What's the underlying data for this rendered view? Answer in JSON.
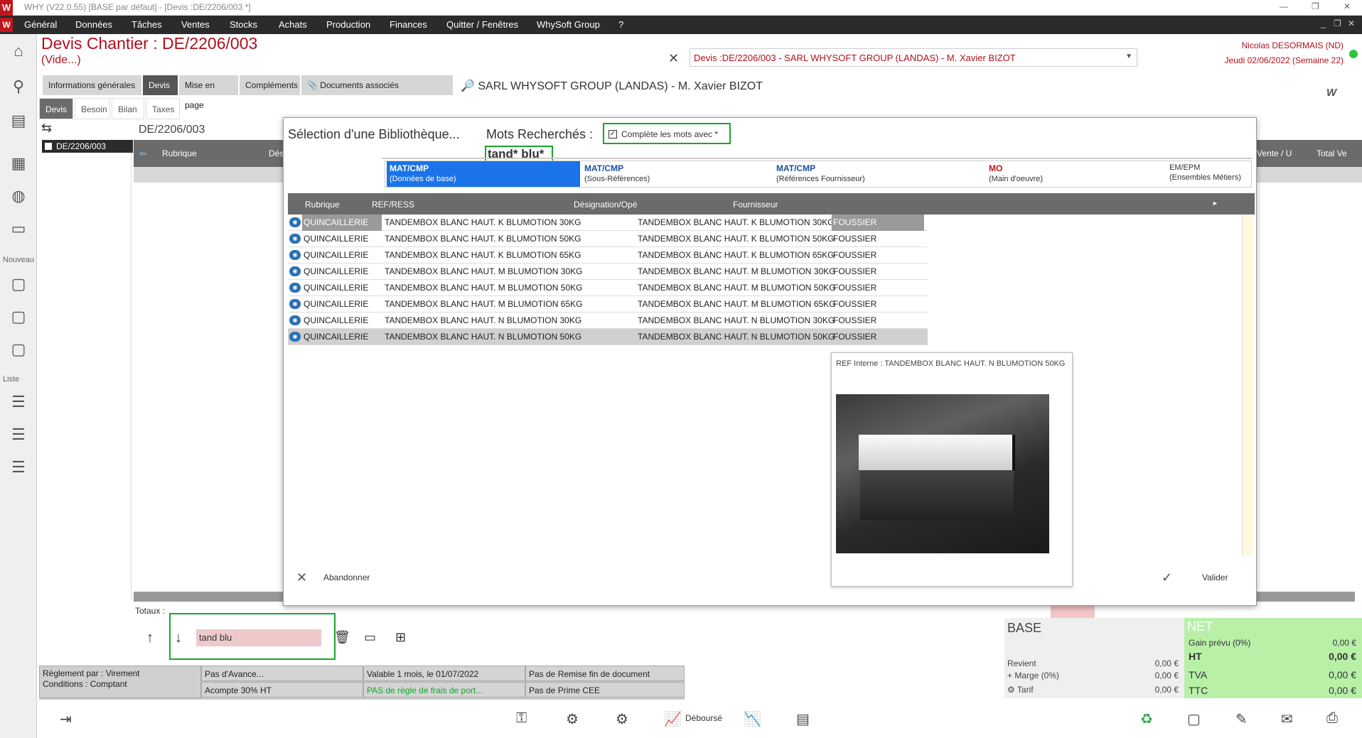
{
  "window": {
    "title": "WHY (V22.0.55)  [BASE par défaut] - [Devis :DE/2206/003 *]"
  },
  "menu": [
    "Général",
    "Données",
    "Tâches",
    "Ventes",
    "Stocks",
    "Achats",
    "Production",
    "Finances",
    "Quitter / Fenêtres",
    "WhySoft Group",
    "?"
  ],
  "header": {
    "title": "Devis  Chantier : DE/2206/003",
    "subtitle": "(Vide...)",
    "client_select": "Devis :DE/2206/003 - SARL WHYSOFT GROUP  (LANDAS) - M. Xavier BIZOT",
    "user": "Nicolas DESORMAIS (ND)",
    "date": "Jeudi 02/06/2022 (Semaine 22)",
    "client_line": "SARL WHYSOFT GROUP  (LANDAS) - M. Xavier BIZOT"
  },
  "tabs_main": [
    "Informations générales",
    "Devis",
    "Mise en page",
    "Compléments",
    "Documents associés"
  ],
  "tabs_sub": [
    "Devis",
    "Besoin",
    "Bilan",
    "Taxes"
  ],
  "sidebar": {
    "section_new": "Nouveau",
    "section_list": "Liste"
  },
  "tree": {
    "node": "DE/2206/003"
  },
  "doc": {
    "ref": "DE/2206/003"
  },
  "grid": {
    "headers": [
      "Rubrique",
      "Dés",
      "Vente / U",
      "Total Ve"
    ]
  },
  "totaux_label": "Totaux :",
  "search_field": "tand blu",
  "base": {
    "title": "BASE",
    "rows": [
      {
        "label": "Revient",
        "value": "0,00 €"
      },
      {
        "label": "+ Marge (0%)",
        "value": "0,00 €"
      },
      {
        "label": "Tarif",
        "value": "0,00 €"
      }
    ]
  },
  "net": {
    "title": "NET",
    "rows": [
      {
        "label": "Gain prévu (0%)",
        "value": "0,00 €"
      },
      {
        "label": "HT",
        "value": "0,00 €"
      },
      {
        "label": "TVA",
        "value": "0,00 €"
      },
      {
        "label": "TTC",
        "value": "0,00 €"
      }
    ]
  },
  "info": {
    "reglement": "Règlement par : Virement",
    "conditions": "Conditions : Comptant",
    "avance": "Pas d'Avance...",
    "acompte": "Acompte 30% HT",
    "valable": "Valable 1 mois, le 01/07/2022",
    "port": "PAS de règle de frais de port...",
    "remise": "Pas de Remise fin de document",
    "prime": "Pas de Prime CEE"
  },
  "toolbar": {
    "debourse": "Déboursé"
  },
  "modal": {
    "title": "Sélection d'une Bibliothèque...",
    "mots_label": "Mots Recherchés :",
    "checkbox_label": "Complète les mots avec *",
    "search_term": "tand* blu*",
    "lib_tabs": [
      {
        "a": "MAT/CMP",
        "b": "(Données de base)"
      },
      {
        "a": "MAT/CMP",
        "b": "(Sous-Références)"
      },
      {
        "a": "MAT/CMP",
        "b": "(Références Fournisseur)"
      },
      {
        "a": "MO",
        "b": "(Main d'oeuvre)"
      },
      {
        "a": "EM/EPM",
        "b": "(Ensembles Métiers)"
      }
    ],
    "list_headers": [
      "Rubrique",
      "REF/RESS",
      "Désignation/Opé",
      "Fournisseur"
    ],
    "rows": [
      {
        "rubrique": "QUINCAILLERIE",
        "ref": "TANDEMBOX BLANC HAUT. K BLUMOTION 30KG",
        "designation": "TANDEMBOX BLANC HAUT. K BLUMOTION 30KG",
        "fournisseur": "FOUSSIER"
      },
      {
        "rubrique": "QUINCAILLERIE",
        "ref": "TANDEMBOX BLANC HAUT. K BLUMOTION 50KG",
        "designation": "TANDEMBOX BLANC HAUT. K BLUMOTION 50KG",
        "fournisseur": "FOUSSIER"
      },
      {
        "rubrique": "QUINCAILLERIE",
        "ref": "TANDEMBOX BLANC HAUT. K BLUMOTION 65KG",
        "designation": "TANDEMBOX BLANC HAUT. K BLUMOTION 65KG",
        "fournisseur": "FOUSSIER"
      },
      {
        "rubrique": "QUINCAILLERIE",
        "ref": "TANDEMBOX BLANC HAUT. M BLUMOTION 30KG",
        "designation": "TANDEMBOX BLANC HAUT. M BLUMOTION 30KG",
        "fournisseur": "FOUSSIER"
      },
      {
        "rubrique": "QUINCAILLERIE",
        "ref": "TANDEMBOX BLANC HAUT. M BLUMOTION 50KG",
        "designation": "TANDEMBOX BLANC HAUT. M BLUMOTION 50KG",
        "fournisseur": "FOUSSIER"
      },
      {
        "rubrique": "QUINCAILLERIE",
        "ref": "TANDEMBOX BLANC HAUT. M BLUMOTION 65KG",
        "designation": "TANDEMBOX BLANC HAUT. M BLUMOTION 65KG",
        "fournisseur": "FOUSSIER"
      },
      {
        "rubrique": "QUINCAILLERIE",
        "ref": "TANDEMBOX BLANC HAUT. N BLUMOTION 30KG",
        "designation": "TANDEMBOX BLANC HAUT. N BLUMOTION 30KG",
        "fournisseur": "FOUSSIER"
      },
      {
        "rubrique": "QUINCAILLERIE",
        "ref": "TANDEMBOX BLANC HAUT. N BLUMOTION 50KG",
        "designation": "TANDEMBOX BLANC HAUT. N BLUMOTION 50KG",
        "fournisseur": "FOUSSIER"
      }
    ],
    "preview_ref": "REF Interne : TANDEMBOX BLANC HAUT. N BLUMOTION 50KG",
    "abandon": "Abandonner",
    "valider": "Valider"
  },
  "colors": {
    "brand": "#c0171e",
    "highlight_green": "#19a52e",
    "active_tab": "#1a73e8"
  }
}
